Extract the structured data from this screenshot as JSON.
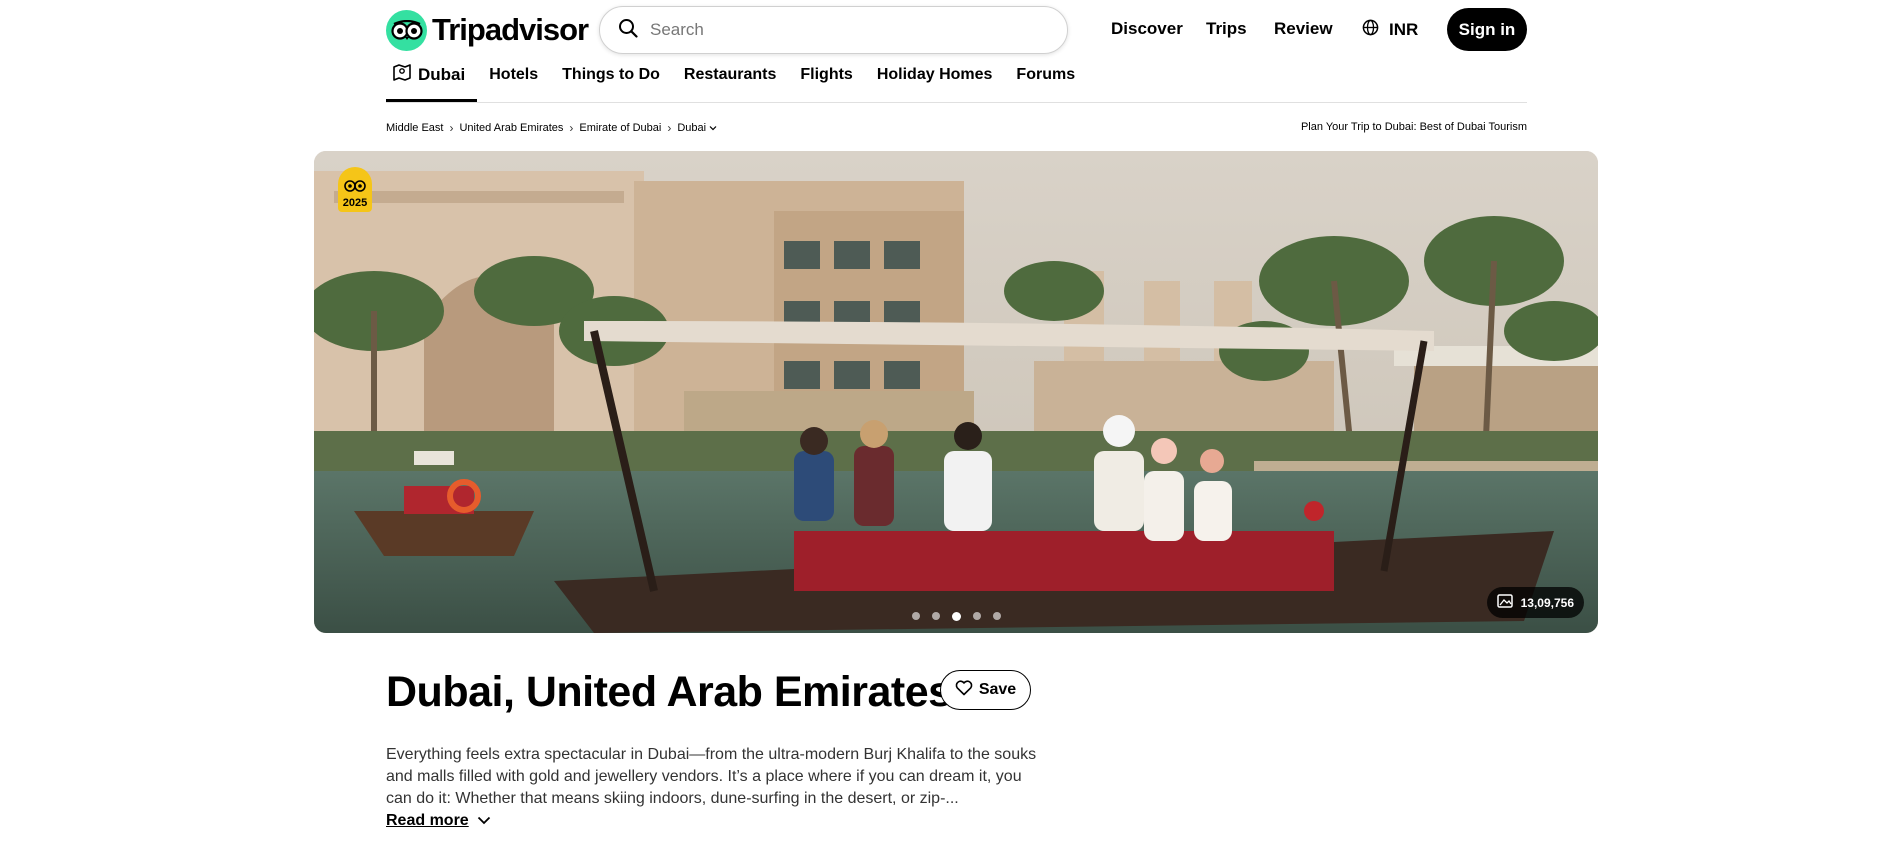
{
  "header": {
    "logo_text": "Tripadvisor",
    "search_placeholder": "Search",
    "nav": [
      "Discover",
      "Trips",
      "Review"
    ],
    "currency": "INR",
    "signin_label": "Sign in"
  },
  "subnav": {
    "items": [
      "Dubai",
      "Hotels",
      "Things to Do",
      "Restaurants",
      "Flights",
      "Holiday Homes",
      "Forums"
    ]
  },
  "breadcrumbs": [
    "Middle East",
    "United Arab Emirates",
    "Emirate of Dubai",
    "Dubai"
  ],
  "plan_link": "Plan Your Trip to Dubai: Best of Dubai Tourism",
  "hero": {
    "award_year": "2025",
    "photo_count": "13,09,756",
    "slides_total": 5,
    "active_slide": 3
  },
  "destination": {
    "title": "Dubai, United Arab Emirates",
    "save_label": "Save",
    "description": "Everything feels extra spectacular in Dubai—from the ultra-modern Burj Khalifa to the souks and malls filled with gold and jewellery vendors. It’s a place where if you can dream it, you can do it: Whether that means skiing indoors, dune-surfing in the desert, or zip-...",
    "read_more_label": "Read more"
  },
  "colors": {
    "brand_green": "#34e0a1",
    "award_yellow": "#f5c518",
    "signin_bg": "#000000"
  }
}
